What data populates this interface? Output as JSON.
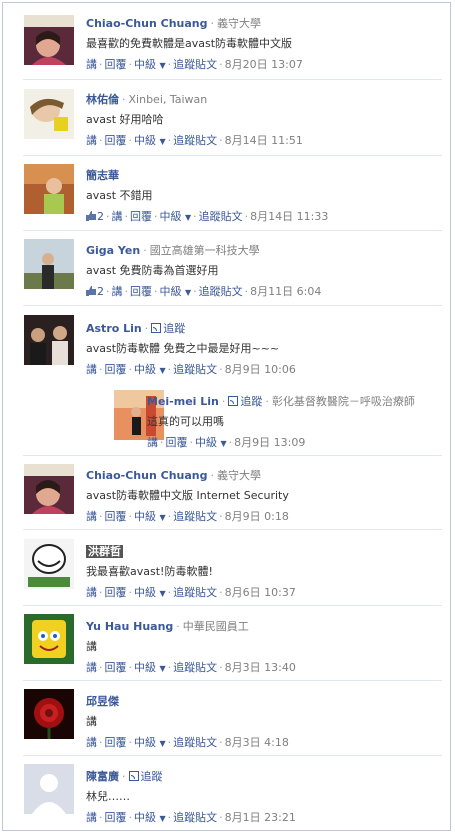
{
  "comments": [
    {
      "name": "Chiao-Chun Chuang",
      "meta": "義守大學",
      "text": "最喜歡的免費軟體是avast防毒軟體中文版",
      "actions": {
        "reply_label": "講",
        "respond_label": "回覆",
        "level": "中級",
        "follow": "追蹤貼文",
        "date": "8月20日 13:07"
      }
    },
    {
      "name": "林佑倫",
      "meta": "Xinbei, Taiwan",
      "text": "avast 好用哈哈",
      "actions": {
        "reply_label": "講",
        "respond_label": "回覆",
        "level": "中級",
        "follow": "追蹤貼文",
        "date": "8月14日 11:51"
      }
    },
    {
      "name": "簡志華",
      "meta": "",
      "text": "avast 不錯用",
      "likes": "2",
      "actions": {
        "reply_label": "講",
        "respond_label": "回覆",
        "level": "中級",
        "follow": "追蹤貼文",
        "date": "8月14日 11:33"
      }
    },
    {
      "name": "Giga Yen",
      "meta": "國立高雄第一科技大學",
      "text": "avast 免費防毒為首選好用",
      "likes": "2",
      "actions": {
        "reply_label": "講",
        "respond_label": "回覆",
        "level": "中級",
        "follow": "追蹤貼文",
        "date": "8月11日 6:04"
      }
    },
    {
      "name": "Astro Lin",
      "follow_label": "追蹤",
      "text": "avast防毒軟體 免費之中最是好用~~~",
      "actions": {
        "reply_label": "講",
        "respond_label": "回覆",
        "level": "中級",
        "follow": "追蹤貼文",
        "date": "8月9日 10:06"
      }
    },
    {
      "name": "Mei-mei Lin",
      "follow_label": "追蹤",
      "meta": "彰化基督教醫院－呼吸治療師",
      "text": "這真的可以用嗎",
      "actions": {
        "reply_label": "講",
        "respond_label": "回覆",
        "level": "中級",
        "date": "8月9日 13:09"
      }
    },
    {
      "name": "Chiao-Chun Chuang",
      "meta": "義守大學",
      "text": "avast防毒軟體中文版 Internet Security",
      "actions": {
        "reply_label": "講",
        "respond_label": "回覆",
        "level": "中級",
        "follow": "追蹤貼文",
        "date": "8月9日 0:18"
      }
    },
    {
      "name": "洪群哲",
      "text": "我最喜歡avast!防毒軟體!",
      "actions": {
        "reply_label": "講",
        "respond_label": "回覆",
        "level": "中級",
        "follow": "追蹤貼文",
        "date": "8月6日 10:37"
      }
    },
    {
      "name": "Yu Hau Huang",
      "meta": "中華民國員工",
      "text": "講",
      "actions": {
        "reply_label": "講",
        "respond_label": "回覆",
        "level": "中級",
        "follow": "追蹤貼文",
        "date": "8月3日 13:40"
      }
    },
    {
      "name": "邱昱傑",
      "text": "講",
      "actions": {
        "reply_label": "講",
        "respond_label": "回覆",
        "level": "中級",
        "follow": "追蹤貼文",
        "date": "8月3日 4:18"
      }
    },
    {
      "name": "陳富廣",
      "follow_label": "追蹤",
      "text": "林兒……",
      "actions": {
        "reply_label": "講",
        "respond_label": "回覆",
        "level": "中級",
        "follow": "追蹤貼文",
        "date": "8月1日 23:21"
      }
    }
  ],
  "colors": {
    "link": "#3b5998",
    "meta": "#808080",
    "border": "#bdc7d8"
  }
}
